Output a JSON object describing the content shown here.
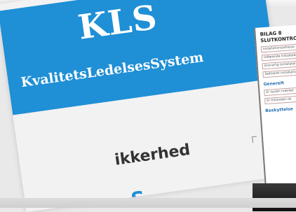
{
  "slide": {
    "acronym": "KLS",
    "full_name": "KvalitetsLedelsesSystem",
    "subtitle": "ikkerhed",
    "partial_text": "S"
  },
  "side_document": {
    "title_line1": "BILAG 8",
    "title_line2": "SLUTKONTROL",
    "rows": [
      "Installationsadresse",
      "Udførende installatør",
      "Ansvarlig installatør",
      "Defineret installation"
    ],
    "heading1": "Generelt",
    "rows2": [
      "Er tavlen mærket",
      "Er tilstanden ok"
    ],
    "heading2": "Beskyttelse"
  },
  "colors": {
    "banner_blue": "#1f8fd6",
    "slide_bg": "#f2f2f2",
    "text_dark": "#333333"
  }
}
